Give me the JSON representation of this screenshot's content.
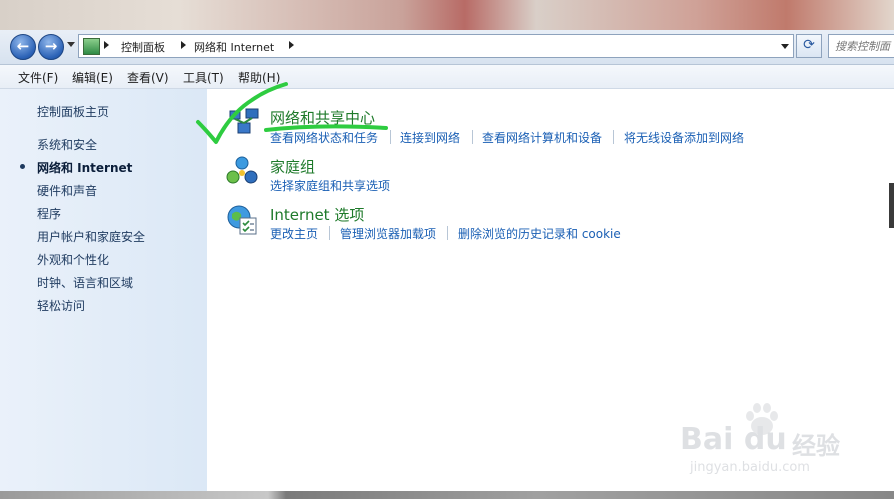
{
  "navigation": {
    "back_label": "←",
    "forward_label": "→",
    "breadcrumb": [
      "控制面板",
      "网络和 Internet"
    ],
    "refresh_label": "⟳",
    "search_placeholder": "搜索控制面"
  },
  "menu": [
    "文件(F)",
    "编辑(E)",
    "查看(V)",
    "工具(T)",
    "帮助(H)"
  ],
  "sidebar": {
    "home": "控制面板主页",
    "items": [
      "系统和安全",
      "网络和 Internet",
      "硬件和声音",
      "程序",
      "用户帐户和家庭安全",
      "外观和个性化",
      "时钟、语言和区域",
      "轻松访问"
    ],
    "active_index": 1
  },
  "categories": [
    {
      "title": "网络和共享中心",
      "icon": "network-sharing-center-icon",
      "tasks": [
        "查看网络状态和任务",
        "连接到网络",
        "查看网络计算机和设备",
        "将无线设备添加到网络"
      ]
    },
    {
      "title": "家庭组",
      "icon": "homegroup-icon",
      "tasks": [
        "选择家庭组和共享选项"
      ]
    },
    {
      "title": "Internet 选项",
      "icon": "internet-options-icon",
      "tasks": [
        "更改主页",
        "管理浏览器加载项",
        "删除浏览的历史记录和 cookie"
      ]
    }
  ],
  "watermark": {
    "brand": "Bai du",
    "product": "经验",
    "url": "jingyan.baidu.com"
  },
  "colors": {
    "link": "#1a5fb4",
    "category_title": "#1e7a2a",
    "annotation": "#2ecc40",
    "sidebar_bg": "#dbe8f6"
  }
}
